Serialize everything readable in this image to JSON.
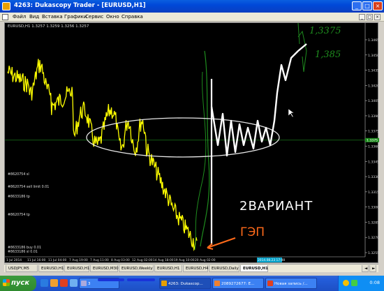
{
  "window": {
    "title": "4263: Dukascopy Trader - [EURUSD,H1]",
    "controls": [
      "_",
      "□",
      "×"
    ]
  },
  "menu": {
    "items": [
      "Файл",
      "Вид",
      "Вставка",
      "Графики",
      "Сервис",
      "Окно",
      "Справка"
    ],
    "mdi_controls": [
      "_",
      "□",
      "×"
    ]
  },
  "chart": {
    "header": "EURUSD,H1  1.3257 1.3259 1.3256 1.3257",
    "price_ticks": [
      "1.3465",
      "1.3450",
      "1.3435",
      "1.3420",
      "1.3405",
      "1.3390",
      "1.3375",
      "1.3360",
      "1.3345",
      "1.3330",
      "1.3315",
      "1.3300",
      "1.3285",
      "1.3270",
      "1.3255"
    ],
    "current_price": "1.3375",
    "time_ticks": [
      "1 Jul 2014",
      "11 Jul 16:00",
      "11 Jul 04:00",
      "7 Aug 19:00",
      "7 Aug 11:00",
      "8 Aug 03:00",
      "12 Aug 02:00",
      "14 Aug 18:00",
      "19 Aug 10:00",
      "20 Aug 02:00",
      "2014.08.23 17:00"
    ],
    "order_labels": [
      "#8620754 sl",
      "#8620754 sell limit 0.01",
      "#8633186 tp",
      "#8620754 tp",
      "#8633186 buy 0.01",
      "#8633186 sl 0.01"
    ],
    "annotations": {
      "variant": "2ВАРИАНТ",
      "gap": "ГЭП",
      "green_top": "1,3375",
      "green_mid": "1,385"
    },
    "colors": {
      "candles": "#ffff00",
      "hand_drawn": "#ffffff",
      "green_drawing": "#1e8c1e",
      "arrow": "#ff6a1a",
      "axis": "#c0c0c0",
      "highlight": "#00a0c8"
    }
  },
  "tabs": [
    "USDJPY,M5",
    "EURUSD,H1",
    "EURUSD,H1",
    "EURUSD,M30",
    "EURUSD,Weekly",
    "EURUSD,H1",
    "EURUSD,H4",
    "EURUSD,Daily",
    "EURUSD,H1"
  ],
  "active_tab_index": 8,
  "taskbar": {
    "start_label": "пуск",
    "buttons": [
      "3",
      "4263: Dukascop...",
      "2089272677: E...",
      "Новая запись /..."
    ],
    "clock": "0:08"
  }
}
